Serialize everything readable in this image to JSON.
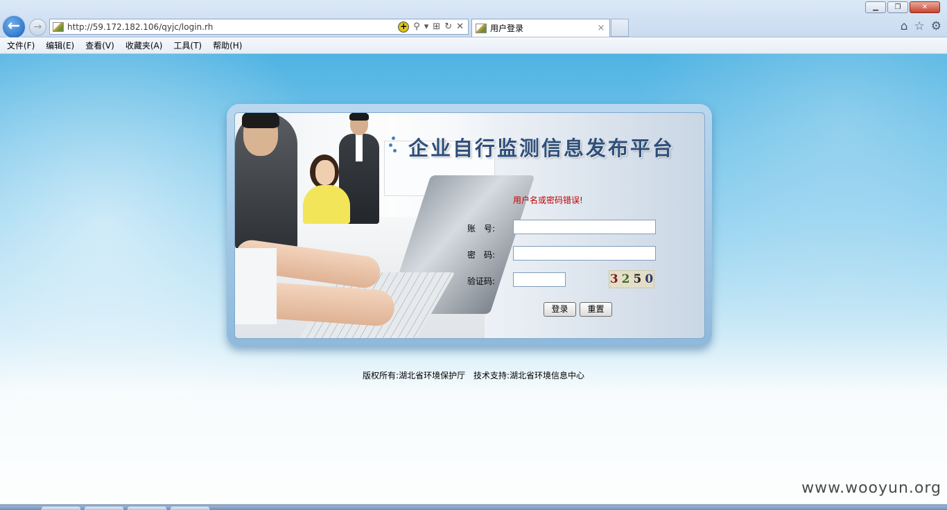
{
  "browser": {
    "url": "http://59.172.182.106/qyjc/login.rh",
    "tab_title": "用户登录",
    "tab_close": "×",
    "back_glyph": "←",
    "forward_glyph": "→",
    "window_controls": {
      "minimize": "▁",
      "restore": "❐",
      "close": "✕"
    },
    "address_icons": {
      "compat": "+",
      "search": "⚲",
      "dropdown": "▾",
      "refresh": "↻",
      "stop": "✕",
      "rss": "⊞"
    },
    "right_icons": {
      "home": "⌂",
      "favorites": "☆",
      "tools": "⚙"
    },
    "menu": [
      "文件(F)",
      "编辑(E)",
      "查看(V)",
      "收藏夹(A)",
      "工具(T)",
      "帮助(H)"
    ]
  },
  "login": {
    "platform_title": "企业自行监测信息发布平台",
    "error": "用户名或密码错误!",
    "account_label": "账　号:",
    "account_value": "",
    "password_label": "密　码:",
    "password_value": "",
    "captcha_label": "验证码:",
    "captcha_value": "",
    "captcha_digits": [
      "3",
      "2",
      "5",
      "0"
    ],
    "login_button": "登录",
    "reset_button": "重置"
  },
  "footer": {
    "copyright": "版权所有:湖北省环境保护厅",
    "support": "技术支持:湖北省环境信息中心"
  },
  "watermark": "www.wooyun.org",
  "colors": {
    "error": "#c00000",
    "title": "#2f4f7a",
    "frame": "#8fb9dc"
  }
}
